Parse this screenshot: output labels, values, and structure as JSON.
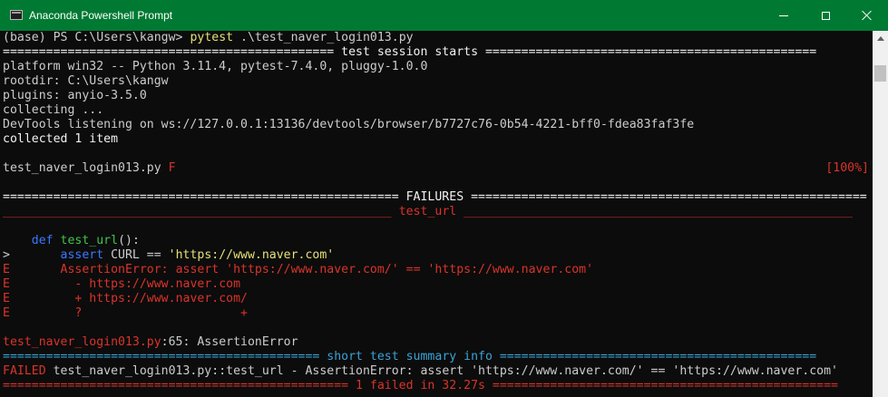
{
  "window": {
    "title": "Anaconda Powershell Prompt",
    "accent": "#007a33",
    "console_bg": "#0c0c0c",
    "controls": {
      "minimize": "minimize-icon",
      "maximize": "maximize-icon",
      "close": "close-icon"
    }
  },
  "console": {
    "prompt": "(base) PS C:\\Users\\kangw> ",
    "command": "pytest",
    "command_args": " .\\test_naver_login013.py",
    "session_header": "============================================== test session starts ==============================================",
    "platform": "platform win32 -- Python 3.11.4, pytest-7.4.0, pluggy-1.0.0",
    "rootdir": "rootdir: C:\\Users\\kangw",
    "plugins": "plugins: anyio-3.5.0",
    "collecting": "collecting ...",
    "devtools": "DevTools listening on ws://127.0.0.1:13136/devtools/browser/b7727c76-0b54-4221-bff0-fdea83faf3fe",
    "collected": "collected 1 item",
    "test_file": "test_naver_login013.py ",
    "test_result": "F",
    "progress": "[100%]",
    "failures_header": "======================================================= FAILURES =======================================================",
    "test_name_bar_left": "______________________________________________________ ",
    "test_name": "test_url",
    "test_name_bar_right": " ______________________________________________________",
    "code": {
      "def_kw": "def",
      "func_name": "test_url",
      "func_rest": "():",
      "marker_current": ">",
      "assert_kw": "assert",
      "assert_var": " CURL == ",
      "assert_str": "'https://www.naver.com'",
      "marker_error": "E",
      "error_line": "AssertionError: assert 'https://www.naver.com/' == 'https://www.naver.com'",
      "diff_minus": "  - https://www.naver.com",
      "diff_plus": "  + https://www.naver.com/",
      "diff_hint": "  ?                      +"
    },
    "location_file": "test_naver_login013.py",
    "location_rest": ":65: AssertionError",
    "summary_header_left": "============================================ ",
    "summary_header_text": "short test summary info",
    "summary_header_right": " ============================================",
    "failed_label": "FAILED",
    "failed_detail": " test_naver_login013.py::test_url - AssertionError: assert 'https://www.naver.com/' == 'https://www.naver.com'",
    "final_line": "================================================ 1 failed in 32.27s ================================================"
  }
}
